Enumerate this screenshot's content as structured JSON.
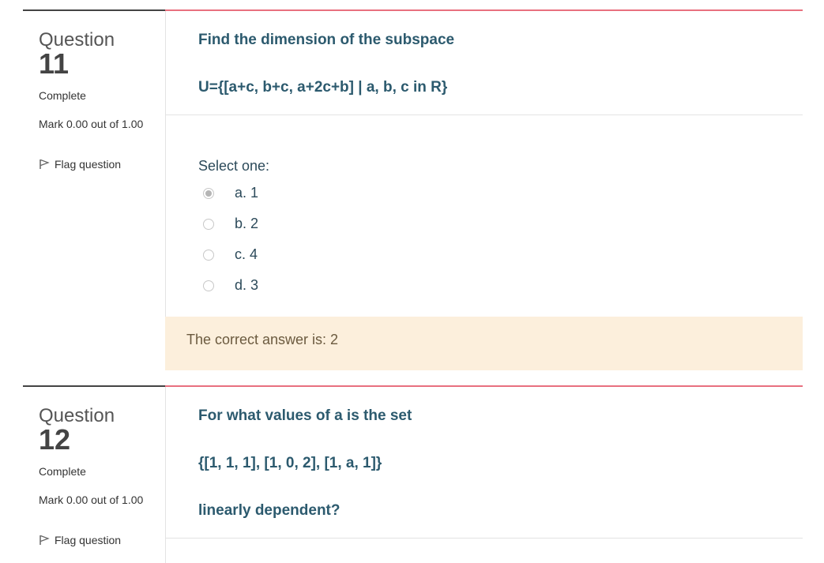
{
  "questions": [
    {
      "label": "Question",
      "number": "11",
      "state": "Complete",
      "grade": "Mark 0.00 out of 1.00",
      "flag_label": "Flag question",
      "text_lines": [
        "Find the dimension of the subspace",
        "U={[a+c, b+c, a+2c+b] | a, b, c in R}"
      ],
      "prompt": "Select one:",
      "options": [
        {
          "label": "a. 1",
          "selected": true
        },
        {
          "label": "b. 2",
          "selected": false
        },
        {
          "label": "c. 4",
          "selected": false
        },
        {
          "label": "d. 3",
          "selected": false
        }
      ],
      "feedback": "The correct answer is: 2"
    },
    {
      "label": "Question",
      "number": "12",
      "state": "Complete",
      "grade": "Mark 0.00 out of 1.00",
      "flag_label": "Flag question",
      "text_lines": [
        "For what values of a is the set",
        "{[1, 1, 1], [1, 0, 2], [1, a, 1]}",
        "linearly dependent?"
      ]
    }
  ],
  "colors": {
    "question_text": "#2c5a6e",
    "accent_line": "#e8707f",
    "feedback_bg": "#fcefdc"
  }
}
